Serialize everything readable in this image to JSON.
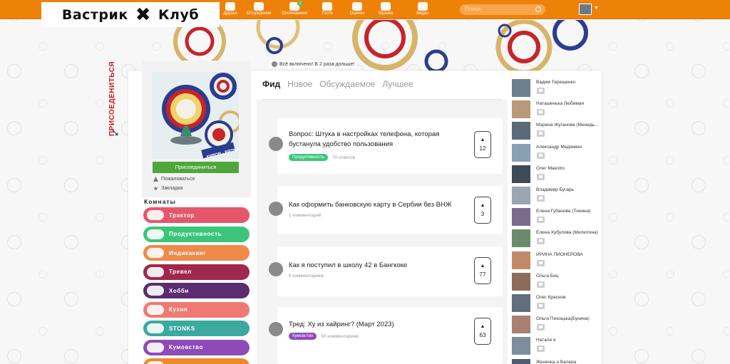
{
  "brand": {
    "logo_text_left": "Вастрик",
    "logo_x": "✖",
    "logo_text_right": "Клуб"
  },
  "nav": {
    "items": [
      {
        "label": "Друзья",
        "icon": "friends-icon"
      },
      {
        "label": "Обсуждения",
        "icon": "discussions-icon"
      },
      {
        "label": "Оповещения",
        "icon": "notifications-icon",
        "badge": "2"
      },
      {
        "label": "Гости",
        "icon": "guests-icon"
      },
      {
        "label": "Оценки",
        "icon": "ratings-icon"
      },
      {
        "label": "Музыка",
        "icon": "music-icon"
      },
      {
        "label": "Видео",
        "icon": "video-icon"
      }
    ],
    "search_placeholder": "Поиск"
  },
  "promo": {
    "text": "Всё включено! В 2 раза дольше!"
  },
  "group": {
    "join_vertical": "ПРИСОЕДЕНИТЬСЯ",
    "badge_text": "КИРОВ - ВЯТКА",
    "join_button": "Присоединиться",
    "complain": "Пожаловаться",
    "bookmark": "Закладка"
  },
  "rooms": {
    "title": "Комнаты",
    "items": [
      {
        "label": "Трактор",
        "color": "#e5566b"
      },
      {
        "label": "Продуктивность",
        "color": "#3cc57a"
      },
      {
        "label": "Индикакинг",
        "color": "#ee8a4a"
      },
      {
        "label": "Тревел",
        "color": "#a0284d"
      },
      {
        "label": "Хобби",
        "color": "#5b2c6f"
      },
      {
        "label": "Кухня",
        "color": "#ef7a73"
      },
      {
        "label": "STONKS",
        "color": "#3aa9a0"
      },
      {
        "label": "Кумовство",
        "color": "#8e4bb8"
      },
      {
        "label": "",
        "color": "#ee8a2a"
      }
    ]
  },
  "feed": {
    "tabs": [
      {
        "label": "Фид",
        "active": true
      },
      {
        "label": "Новое",
        "active": false
      },
      {
        "label": "Обсуждаемое",
        "active": false
      },
      {
        "label": "Лучшее",
        "active": false
      }
    ],
    "posts": [
      {
        "title": "Вопрос: Штука в настройках телефона, которая бустанула удобство пользования",
        "tag": "Продуктивность",
        "tag_color": "#3cc57a",
        "meta": "70 ответов",
        "votes": "12"
      },
      {
        "title": "Как оформить банковскую карту в Сербии без ВНЖ",
        "tag": "",
        "tag_color": "",
        "meta": "1 комментарий",
        "votes": "3"
      },
      {
        "title": "Как я поступил в школу 42 в Бангкоке",
        "tag": "",
        "tag_color": "",
        "meta": "6 комментариев",
        "votes": "77"
      },
      {
        "title": "Тред: Ху из хайринг? (Март 2023)",
        "tag": "Кумовство",
        "tag_color": "#8e4bb8",
        "meta": "50 комментариев",
        "votes": "63"
      }
    ]
  },
  "members": [
    "Вадим Терещенко",
    "Наташенька Любимая",
    "Марина Жуганова (Менедь...",
    "Александр Медянкин",
    "Олег Maestro",
    "Владимир Бугарь",
    "Елена Губанова (Тинина)",
    "Елена Хубулова (Милютина)",
    "ИРИНА ПИОНЕРОВА",
    "Ольга Биц",
    "Олег Краснов",
    "Ольга Пихоцька(Бунина)",
    "Натали я",
    "Женечка и Валера"
  ]
}
